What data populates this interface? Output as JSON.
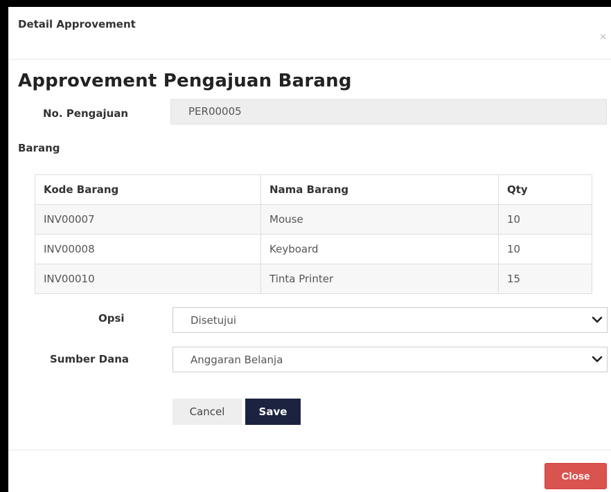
{
  "modal": {
    "title": "Detail Approvement",
    "close_icon": "×"
  },
  "form": {
    "heading": "Approvement Pengajuan Barang",
    "no_pengajuan_label": "No. Pengajuan",
    "no_pengajuan_value": "PER00005",
    "barang_label": "Barang",
    "table": {
      "headers": [
        "Kode Barang",
        "Nama Barang",
        "Qty"
      ],
      "rows": [
        [
          "INV00007",
          "Mouse",
          "10"
        ],
        [
          "INV00008",
          "Keyboard",
          "10"
        ],
        [
          "INV00010",
          "Tinta Printer",
          "15"
        ]
      ]
    },
    "opsi_label": "Opsi",
    "opsi_value": "Disetujui",
    "sumber_dana_label": "Sumber Dana",
    "sumber_dana_value": "Anggaran Belanja",
    "cancel_label": "Cancel",
    "save_label": "Save"
  },
  "footer": {
    "close_label": "Close"
  },
  "colors": {
    "save_bg": "#1b2340",
    "close_bg": "#d9534f"
  },
  "icons": {
    "dropdown": "chevron-down-icon",
    "close": "close-icon"
  }
}
